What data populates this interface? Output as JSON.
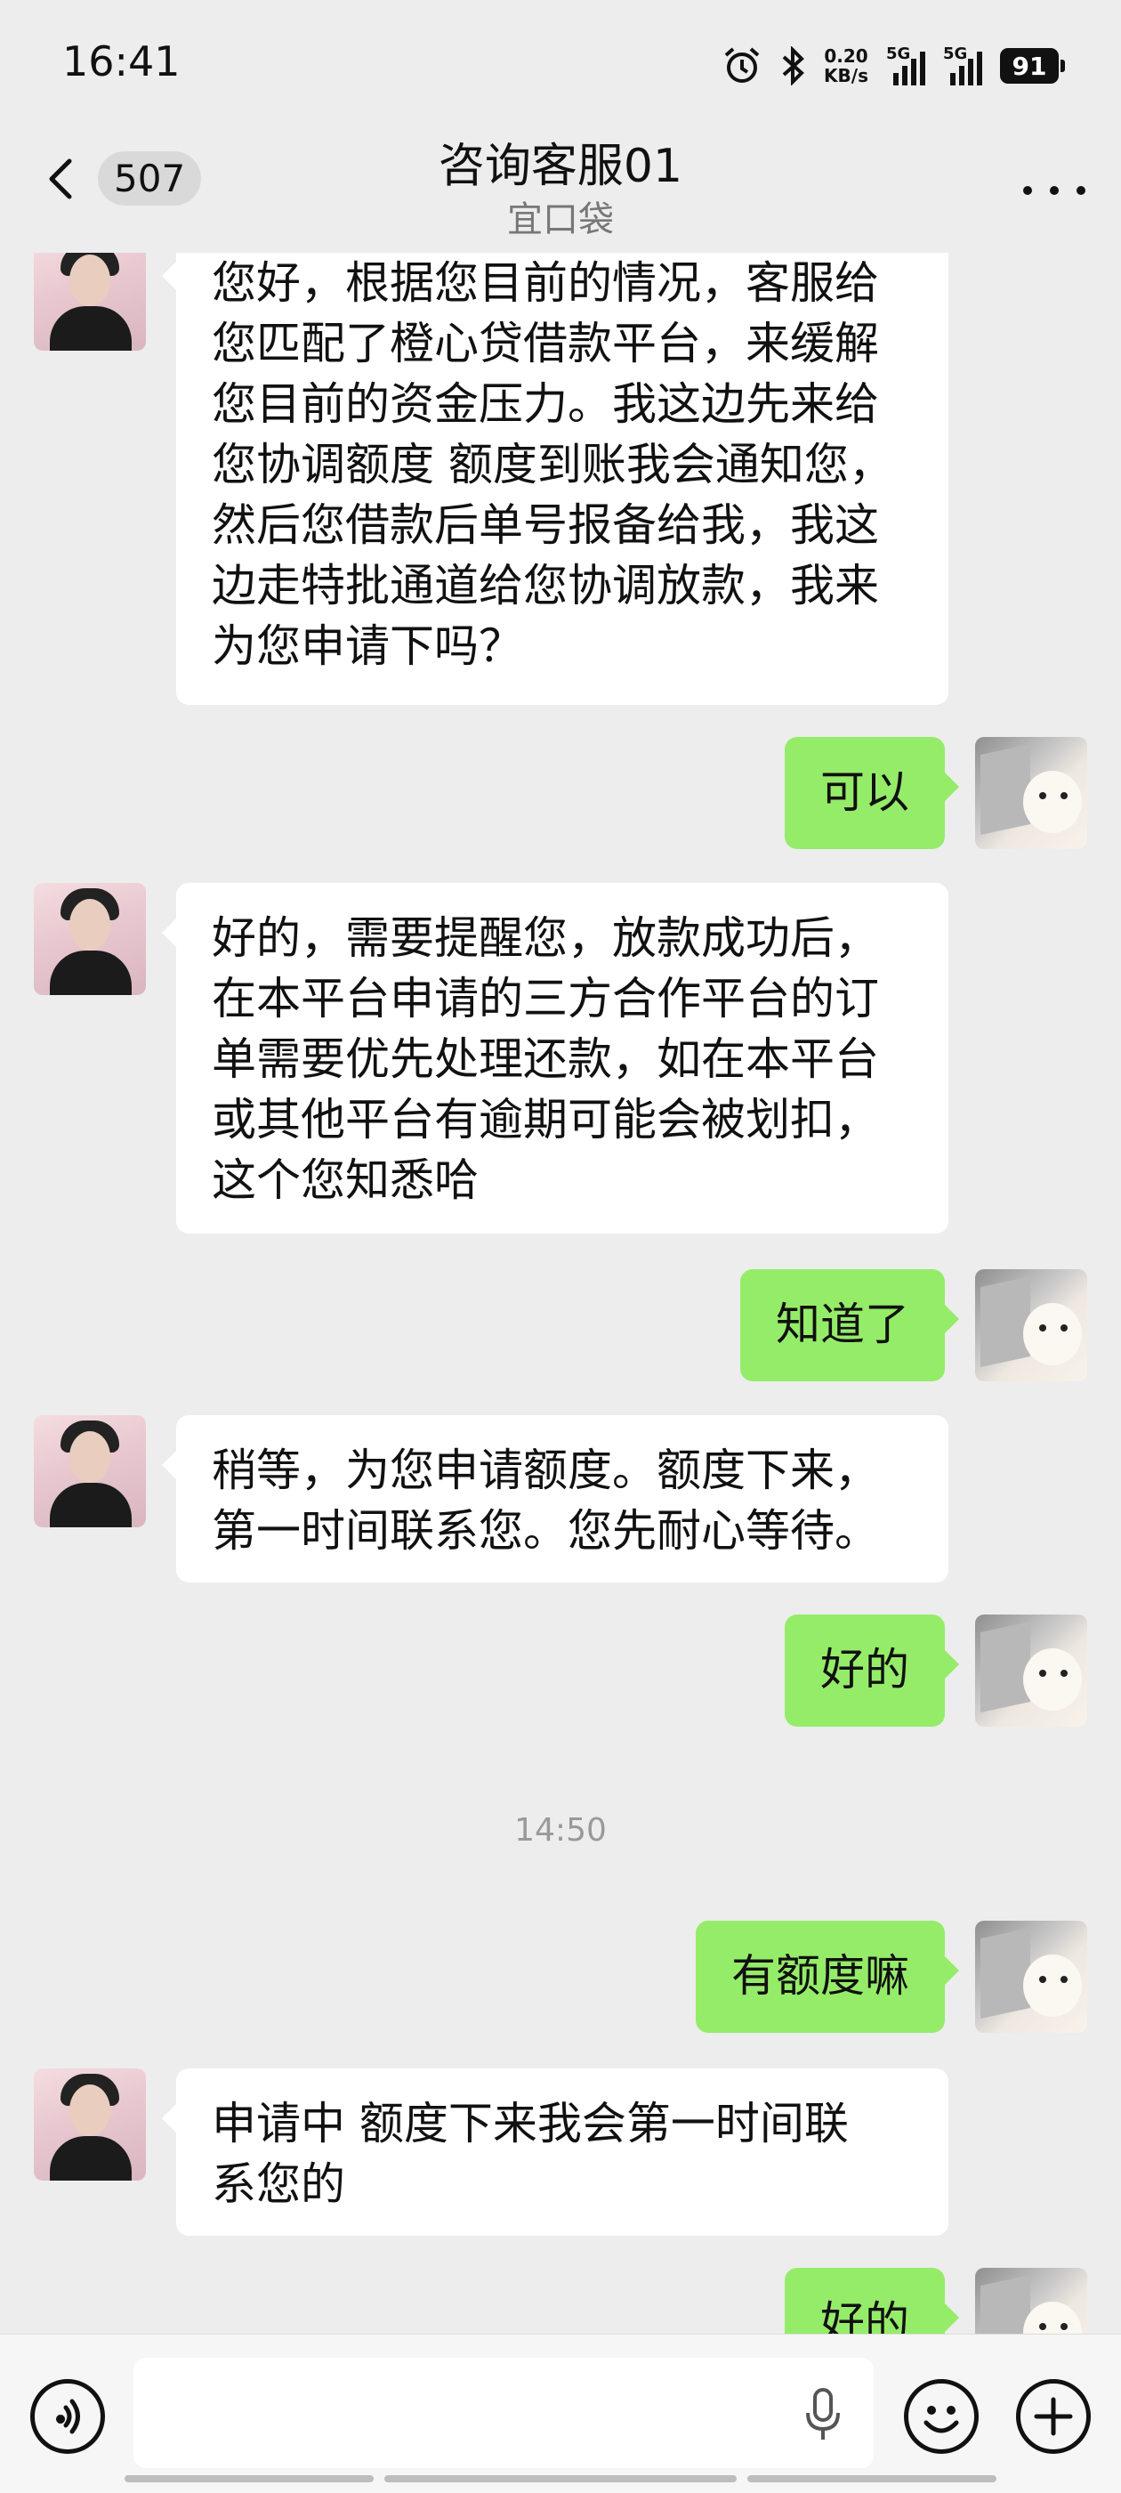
{
  "status_bar": {
    "time": "16:41",
    "net_speed_value": "0.20",
    "net_speed_unit": "KB/s",
    "sim1": "5G",
    "sim2": "5G",
    "battery": "91"
  },
  "nav": {
    "unread_count": "507",
    "title": "咨询客服01",
    "subtitle": "宜口袋"
  },
  "messages": [
    {
      "from": "agent",
      "text": "您好，根据您目前的情况，客服给\n您匹配了橙心贷借款平台，来缓解\n您目前的资金压力。我这边先来给\n您协调额度 额度到账我会通知您，\n然后您借款后单号报备给我，我这\n边走特批通道给您协调放款，我来\n为您申请下吗？"
    },
    {
      "from": "user",
      "text": "可以"
    },
    {
      "from": "agent",
      "text": "好的，需要提醒您，放款成功后，\n在本平台申请的三方合作平台的订\n单需要优先处理还款，如在本平台\n或其他平台有逾期可能会被划扣，\n这个您知悉哈"
    },
    {
      "from": "user",
      "text": "知道了"
    },
    {
      "from": "agent",
      "text": "稍等，为您申请额度。额度下来，\n第一时间联系您。您先耐心等待。"
    },
    {
      "from": "user",
      "text": "好的"
    },
    {
      "from": "time",
      "text": "14:50"
    },
    {
      "from": "user",
      "text": "有额度嘛"
    },
    {
      "from": "agent",
      "text": "申请中 额度下来我会第一时间联\n系您的"
    },
    {
      "from": "user",
      "text": "好的"
    }
  ],
  "input": {
    "value": "",
    "placeholder": ""
  },
  "icons": [
    "back-arrow-icon",
    "more-icon",
    "voice-icon",
    "microphone-icon",
    "emoji-icon",
    "plus-icon",
    "alarm-icon",
    "bluetooth-icon"
  ],
  "colors": {
    "background": "#ededed",
    "user_bubble": "#95ec69",
    "agent_bubble": "#ffffff"
  }
}
